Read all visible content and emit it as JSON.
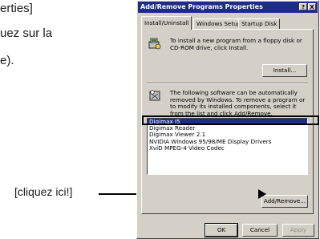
{
  "doc": {
    "line1": "erties]",
    "line2": "uez sur la",
    "line3": "e).",
    "callout": "[cliquez ici!]"
  },
  "dialog": {
    "title": "Add/Remove Programs Properties",
    "help_button": "?",
    "close_button": "X",
    "tabs": [
      "Install/Uninstall",
      "Windows Setup",
      "Startup Disk"
    ],
    "install_text": "To install a new program from a floppy disk or CD-ROM drive, click Install.",
    "install_button": "Install...",
    "remove_text": "The following software can be automatically removed by Windows. To remove a program or to modify its installed components, select it from the list and click Add/Remove.",
    "programs": [
      "Digimax I5",
      "Digimax Reader",
      "Digimax Viewer 2.1",
      "NVIDIA Windows 95/98/ME Display Drivers",
      "XviD MPEG-4 Video Codec"
    ],
    "selected_program": "Digimax I5",
    "add_remove_button": "Add/Remove...",
    "ok_button": "OK",
    "cancel_button": "Cancel",
    "apply_button": "Apply"
  },
  "colors": {
    "titlebar": "#1b2c8a",
    "face": "#d4d0c8",
    "selection": "#1b2c8a"
  }
}
